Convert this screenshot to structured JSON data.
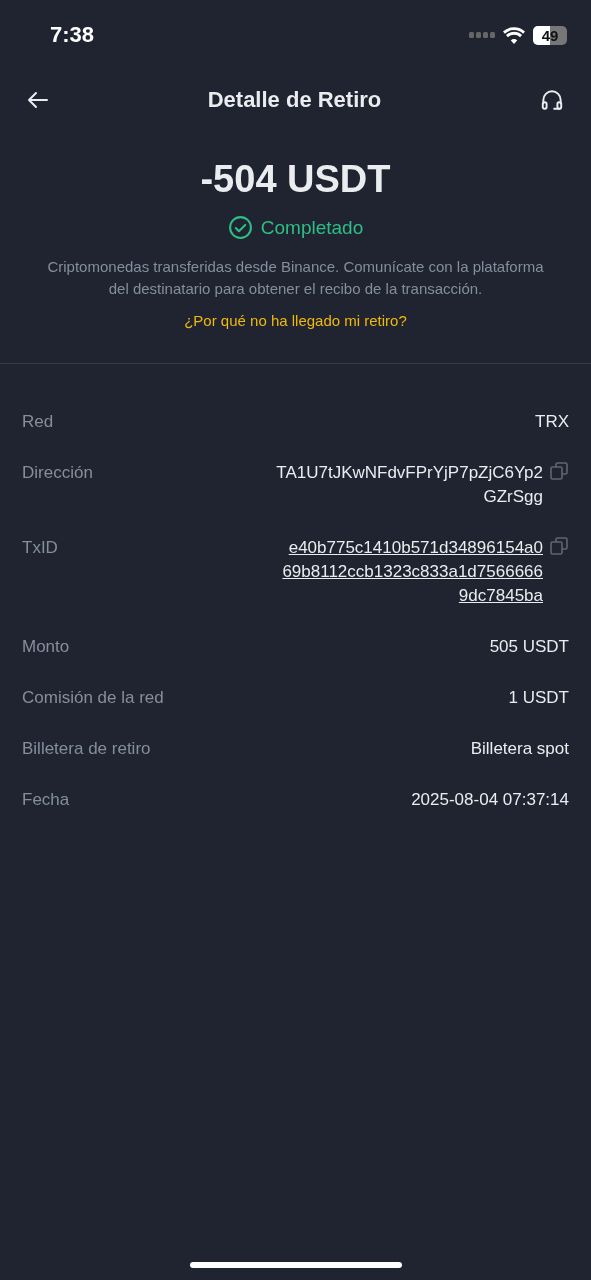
{
  "status_bar": {
    "time": "7:38",
    "battery": "49"
  },
  "header": {
    "title": "Detalle de Retiro"
  },
  "summary": {
    "amount": "-504 USDT",
    "status": "Completado",
    "description": "Criptomonedas transferidas desde Binance. Comunícate con la plataforma del destinatario para obtener el recibo de la transacción.",
    "help_link": "¿Por qué no ha llegado mi retiro?"
  },
  "details": [
    {
      "kind": "plain",
      "label": "Red",
      "lines": [
        "TRX"
      ]
    },
    {
      "kind": "copy",
      "label": "Dirección",
      "lines": [
        "TA1U7tJKwNFdvFPrYjP7pZjC6Yp2",
        "GZrSgg"
      ]
    },
    {
      "kind": "link",
      "label": "TxID",
      "lines": [
        "e40b775c1410b571d34896154a0",
        "69b8112ccb1323c833a1d7566666",
        "9dc7845ba"
      ]
    },
    {
      "kind": "plain",
      "label": "Monto",
      "lines": [
        "505 USDT"
      ]
    },
    {
      "kind": "plain",
      "label": "Comisión de la red",
      "lines": [
        "1 USDT"
      ]
    },
    {
      "kind": "plain",
      "label": "Billetera de retiro",
      "lines": [
        "Billetera spot"
      ]
    },
    {
      "kind": "plain",
      "label": "Fecha",
      "lines": [
        "2025-08-04 07:37:14"
      ]
    }
  ]
}
